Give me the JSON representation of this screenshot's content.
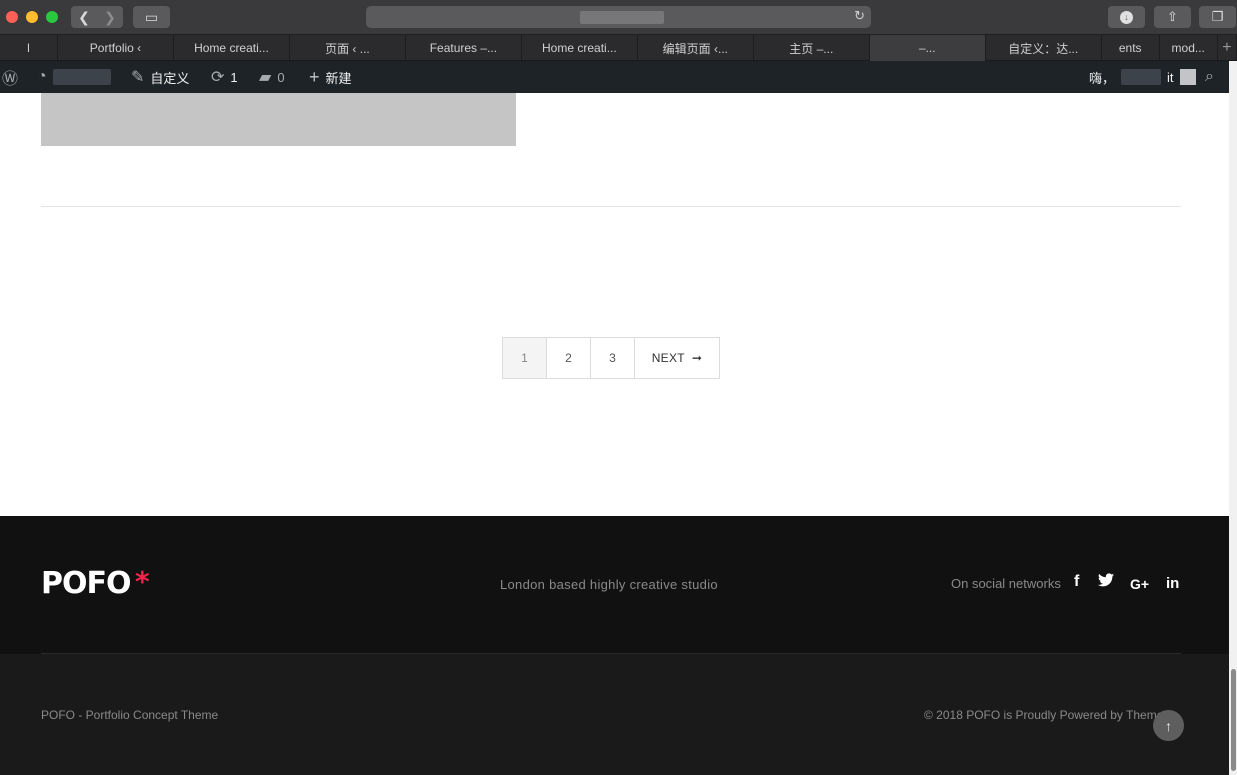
{
  "browser": {
    "tabs": [
      {
        "label": "l",
        "narrow": true
      },
      {
        "label": "Portfolio ‹"
      },
      {
        "label": "Home creati..."
      },
      {
        "label": "页面 ‹ ..."
      },
      {
        "label": "Features –..."
      },
      {
        "label": "Home creati..."
      },
      {
        "label": "编辑页面 ‹..."
      },
      {
        "label": "主页 –..."
      },
      {
        "label": "–...",
        "active": true
      },
      {
        "label": "自定义：达..."
      },
      {
        "label": "ents",
        "narrow": true
      },
      {
        "label": "mod...",
        "narrow": true
      }
    ],
    "new_tab": "+"
  },
  "adminbar": {
    "customize_label": "自定义",
    "updates_count": "1",
    "comments_count": "0",
    "new_label": "新建",
    "greeting": "嗨，",
    "user_suffix": "it"
  },
  "pagination": {
    "pages": [
      "1",
      "2",
      "3"
    ],
    "current": "1",
    "next_label": "NEXT",
    "next_arrow": "➞"
  },
  "footer": {
    "logo_text": "POFO",
    "logo_star": "*",
    "tagline": "London based highly creative studio",
    "social_label": "On social networks",
    "social_icons": {
      "facebook": "f",
      "twitter": "🐦",
      "googleplus": "G+",
      "linkedin": "in"
    },
    "copyright_left": "POFO - Portfolio Concept Theme",
    "copyright_right": "© 2018 POFO is Proudly Powered by  Themes"
  },
  "colors": {
    "accent": "#f0264b",
    "adminbar": "#1d2327",
    "footer_top": "#111111",
    "footer_bottom": "#1a1a1a"
  }
}
